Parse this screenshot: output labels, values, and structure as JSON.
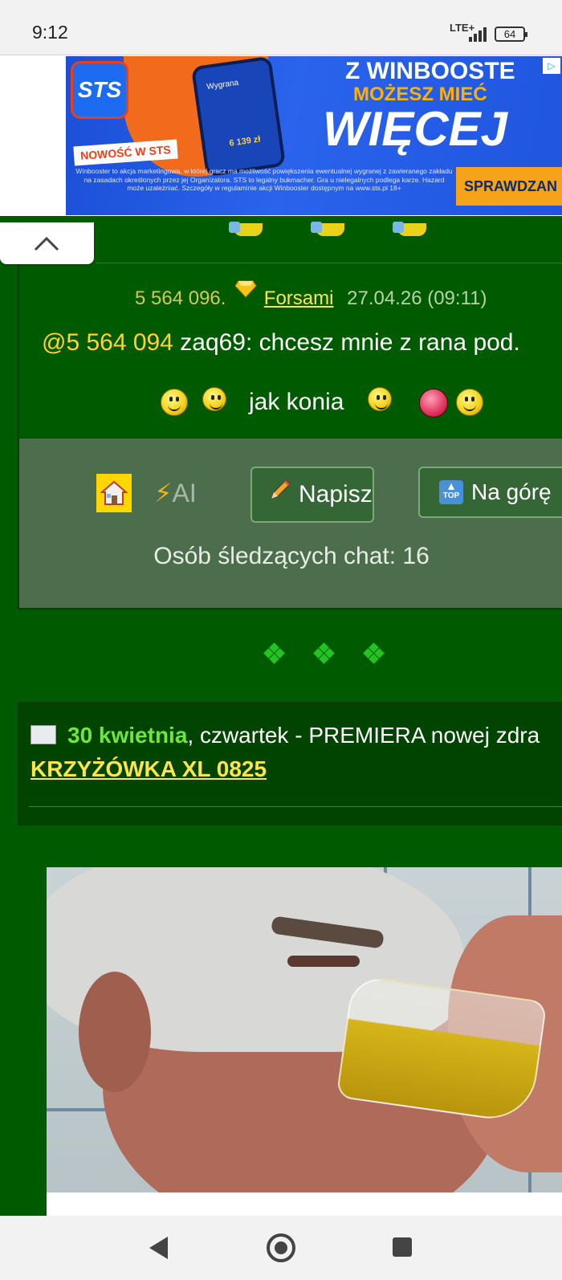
{
  "status_bar": {
    "time": "9:12",
    "network": "LTE+",
    "battery": "64"
  },
  "ad": {
    "logo": "STS",
    "badge": "NOWOŚĆ W STS",
    "headline_1": "Z WINBOOSTE",
    "headline_2": "MOŻESZ MIEĆ",
    "headline_3": "WIĘCEJ",
    "fine_print": "Winbooster to akcja marketingowa, w której gracz ma możliwość powiększenia ewentualnej wygranej z zawieranego zakładu na zasadach określonych przez jej Organizatora. STS to legalny bukmacher. Gra u nielegalnych podlega karze. Hazard może uzależniać. Szczegóły w regulaminie akcji Winbooster dostępnym na www.sts.pl 18+",
    "cta": "SPRAWDZAN",
    "phone_text": "Wygrana",
    "phone_amount": "6 139 zł"
  },
  "message": {
    "number": "5 564 096.",
    "author": "Forsami",
    "date": "27.04.26 (09:11)",
    "mention": "@5 564 094",
    "text": " zaq69: chcesz mnie z rana pod.",
    "caption": "jak konia"
  },
  "toolbar": {
    "ai_label": "AI",
    "write_label": "Napisz",
    "top_label": "Na górę",
    "top_icon_text": "TOP",
    "followers": "Osób śledzących chat: 16"
  },
  "news": {
    "date_highlight": "30 kwietnia",
    "rest": ", czwartek - PREMIERA nowej zdra",
    "link": "KRZYŻÓWKA XL 0825"
  },
  "icons": {
    "up": "chevron-up-icon",
    "home": "house-icon",
    "bolt": "lightning-icon",
    "pencil": "pencil-icon",
    "top": "top-arrow-icon",
    "newspaper": "newspaper-icon",
    "back": "back-triangle-icon",
    "home_nav": "home-circle-icon",
    "recents": "recents-square-icon"
  },
  "colors": {
    "page_background": "#005a00",
    "panel": "#4c6e4c",
    "mention": "#ffd331",
    "link": "#ffe54a",
    "date_highlight": "#6fe63a"
  }
}
